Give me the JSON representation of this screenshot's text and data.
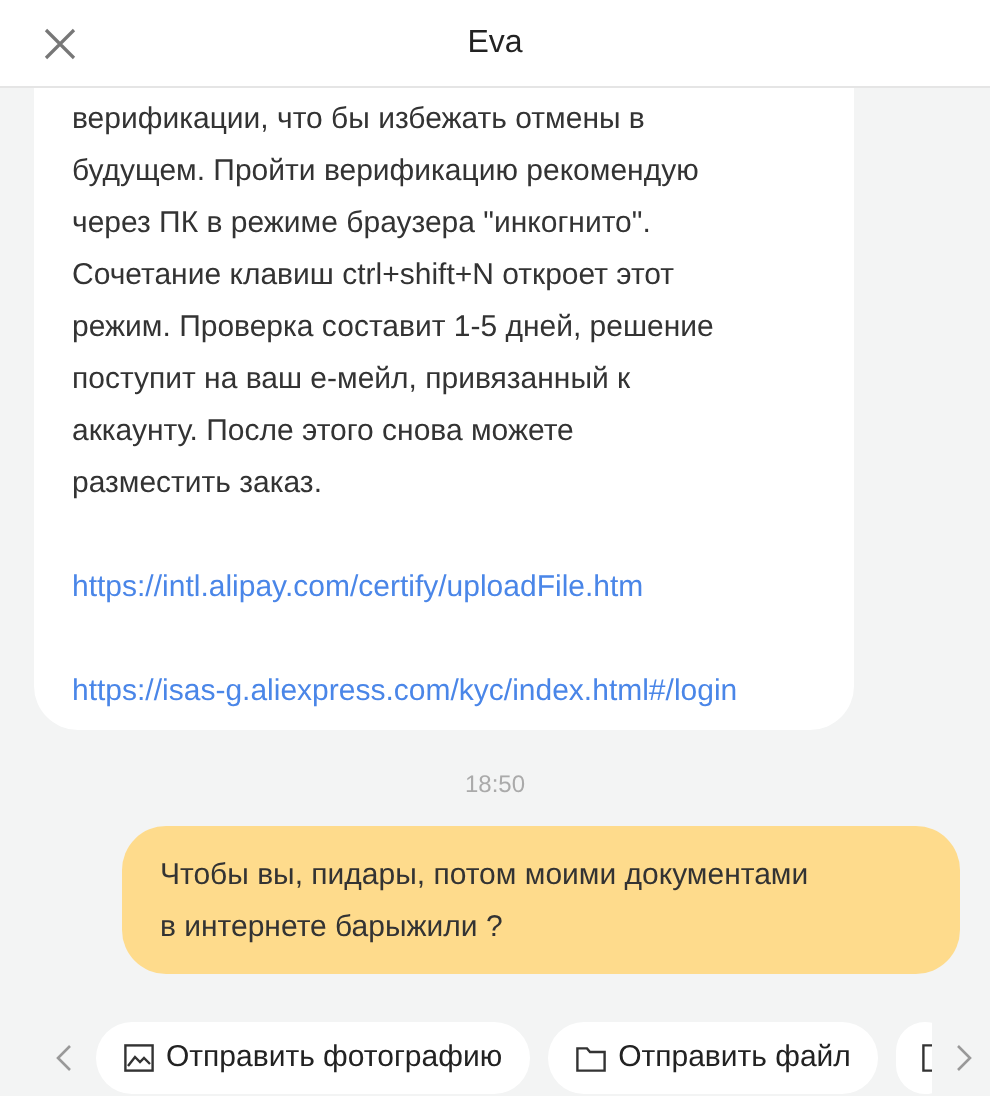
{
  "header": {
    "title": "Eva"
  },
  "messages": [
    {
      "kind": "incoming",
      "text": "верификации, что бы избежать отмены в\nбудущем. Пройти верификацию рекомендую\nчерез ПК в режиме браузера \"инкогнито\".\nСочетание клавиш ctrl+shift+N откроет этот\nрежим. Проверка составит 1-5 дней, решение\nпоступит на ваш е-мейл, привязанный к\nаккаунту. После этого снова можете\nразместить заказ.",
      "links": [
        "https://intl.alipay.com/certify/uploadFile.htm",
        "https://isas-g.aliexpress.com/kyc/index.html#/login"
      ]
    },
    {
      "kind": "time",
      "text": "18:50"
    },
    {
      "kind": "outgoing",
      "text": "Чтобы вы, пидары, потом моими документами\nв интернете барыжили ?"
    }
  ],
  "quick_actions": [
    {
      "kind": "photo",
      "label": "Отправить фотографию"
    },
    {
      "kind": "file",
      "label": "Отправить файл"
    },
    {
      "kind": "partial"
    }
  ]
}
